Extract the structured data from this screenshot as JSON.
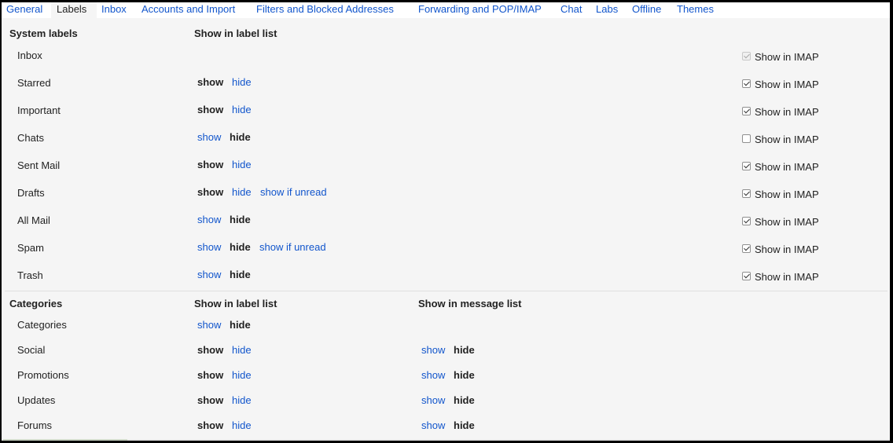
{
  "tabs": [
    {
      "label": "General"
    },
    {
      "label": "Labels",
      "active": true
    },
    {
      "label": "Inbox"
    },
    {
      "label": "Accounts and Import"
    },
    {
      "label": "Filters and Blocked Addresses"
    },
    {
      "label": "Forwarding and POP/IMAP"
    },
    {
      "label": "Chat"
    },
    {
      "label": "Labs"
    },
    {
      "label": "Offline"
    },
    {
      "label": "Themes"
    }
  ],
  "system": {
    "header": "System labels",
    "col_label_list": "Show in label list",
    "imap_label": "Show in IMAP",
    "rows": [
      {
        "name": "Inbox",
        "options": [],
        "imap": true,
        "imap_disabled": true
      },
      {
        "name": "Starred",
        "options": [
          {
            "text": "show",
            "selected": true
          },
          {
            "text": "hide",
            "selected": false
          }
        ],
        "imap": true
      },
      {
        "name": "Important",
        "options": [
          {
            "text": "show",
            "selected": true
          },
          {
            "text": "hide",
            "selected": false
          }
        ],
        "imap": true
      },
      {
        "name": "Chats",
        "options": [
          {
            "text": "show",
            "selected": false
          },
          {
            "text": "hide",
            "selected": true
          }
        ],
        "imap": false
      },
      {
        "name": "Sent Mail",
        "options": [
          {
            "text": "show",
            "selected": true
          },
          {
            "text": "hide",
            "selected": false
          }
        ],
        "imap": true
      },
      {
        "name": "Drafts",
        "options": [
          {
            "text": "show",
            "selected": true
          },
          {
            "text": "hide",
            "selected": false
          },
          {
            "text": "show if unread",
            "selected": false
          }
        ],
        "imap": true
      },
      {
        "name": "All Mail",
        "options": [
          {
            "text": "show",
            "selected": false
          },
          {
            "text": "hide",
            "selected": true
          }
        ],
        "imap": true
      },
      {
        "name": "Spam",
        "options": [
          {
            "text": "show",
            "selected": false
          },
          {
            "text": "hide",
            "selected": true
          },
          {
            "text": "show if unread",
            "selected": false
          }
        ],
        "imap": true
      },
      {
        "name": "Trash",
        "options": [
          {
            "text": "show",
            "selected": false
          },
          {
            "text": "hide",
            "selected": true
          }
        ],
        "imap": true
      }
    ]
  },
  "categories": {
    "header": "Categories",
    "col_label_list": "Show in label list",
    "col_message_list": "Show in message list",
    "rows": [
      {
        "name": "Categories",
        "label_options": [
          {
            "text": "show",
            "selected": false
          },
          {
            "text": "hide",
            "selected": true
          }
        ],
        "message_options": []
      },
      {
        "name": "Social",
        "label_options": [
          {
            "text": "show",
            "selected": true
          },
          {
            "text": "hide",
            "selected": false
          }
        ],
        "message_options": [
          {
            "text": "show",
            "selected": false
          },
          {
            "text": "hide",
            "selected": true
          }
        ]
      },
      {
        "name": "Promotions",
        "label_options": [
          {
            "text": "show",
            "selected": true
          },
          {
            "text": "hide",
            "selected": false
          }
        ],
        "message_options": [
          {
            "text": "show",
            "selected": false
          },
          {
            "text": "hide",
            "selected": true
          }
        ]
      },
      {
        "name": "Updates",
        "label_options": [
          {
            "text": "show",
            "selected": true
          },
          {
            "text": "hide",
            "selected": false
          }
        ],
        "message_options": [
          {
            "text": "show",
            "selected": false
          },
          {
            "text": "hide",
            "selected": true
          }
        ]
      },
      {
        "name": "Forums",
        "label_options": [
          {
            "text": "show",
            "selected": true
          },
          {
            "text": "hide",
            "selected": false
          }
        ],
        "message_options": [
          {
            "text": "show",
            "selected": false
          },
          {
            "text": "hide",
            "selected": true
          }
        ]
      }
    ]
  },
  "colors": {
    "link": "#1155cc",
    "text": "#222222",
    "background": "#f5f5f5"
  }
}
